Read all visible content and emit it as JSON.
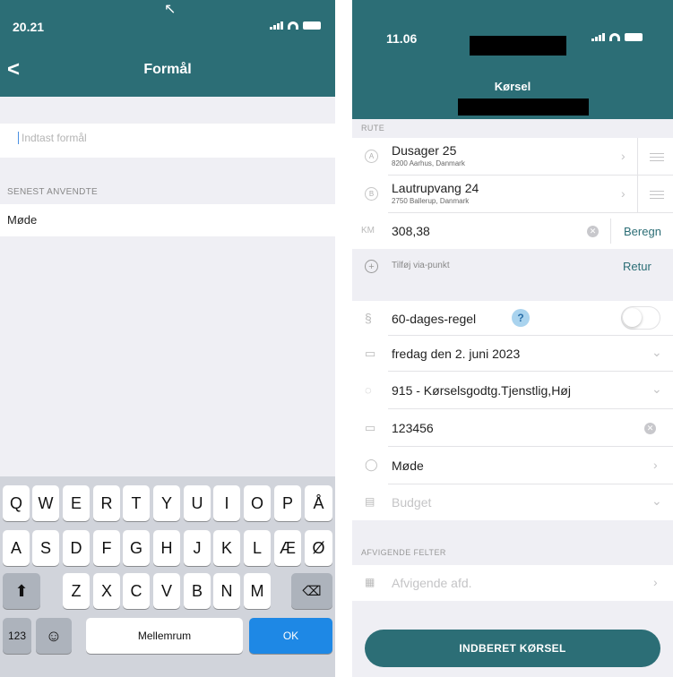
{
  "left_screen": {
    "status_bar": {
      "time": "20.21"
    },
    "nav": {
      "back": "<",
      "title": "Formål"
    },
    "input": {
      "placeholder": "Indtast formål",
      "value": ""
    },
    "recent_section": {
      "header": "SENEST ANVENDTE",
      "items": [
        "Møde"
      ]
    },
    "keyboard": {
      "row1": [
        "Q",
        "W",
        "E",
        "R",
        "T",
        "Y",
        "U",
        "I",
        "O",
        "P",
        "Å"
      ],
      "row2": [
        "A",
        "S",
        "D",
        "F",
        "G",
        "H",
        "J",
        "K",
        "L",
        "Æ",
        "Ø"
      ],
      "row3": [
        "Z",
        "X",
        "C",
        "V",
        "B",
        "N",
        "M"
      ],
      "shift": "⬆",
      "backspace": "⌫",
      "numbers": "123",
      "emoji": "☺",
      "space": "Mellemrum",
      "ok": "OK"
    }
  },
  "right_screen": {
    "status_bar": {
      "time": "11.06"
    },
    "header": {
      "title": "Kørsel"
    },
    "route_section": {
      "header": "RUTE"
    },
    "route": [
      {
        "marker": "A",
        "street": "Dusager 25",
        "city": "8200 Aarhus, Danmark"
      },
      {
        "marker": "B",
        "street": "Lautrupvang 24",
        "city": "2750 Ballerup, Danmark"
      }
    ],
    "km": {
      "label": "KM",
      "value": "308,38",
      "calculate": "Beregn"
    },
    "via": {
      "label": "Tilføj via-punkt",
      "return": "Retur"
    },
    "rule": {
      "symbol": "§",
      "label": "60-dages-regel",
      "help": "?",
      "enabled": false
    },
    "date": {
      "label": "fredag den 2. juni 2023"
    },
    "rate": {
      "label": "915 - Kørselsgodtg.Tjenstlig,Høj"
    },
    "plate": {
      "label": "123456"
    },
    "purpose": {
      "label": "Møde"
    },
    "budget": {
      "label": "Budget"
    },
    "deviating_section": {
      "header": "AFVIGENDE FELTER"
    },
    "deviating": {
      "label": "Afvigende afd."
    },
    "submit": {
      "label": "INDBERET KØRSEL"
    }
  }
}
